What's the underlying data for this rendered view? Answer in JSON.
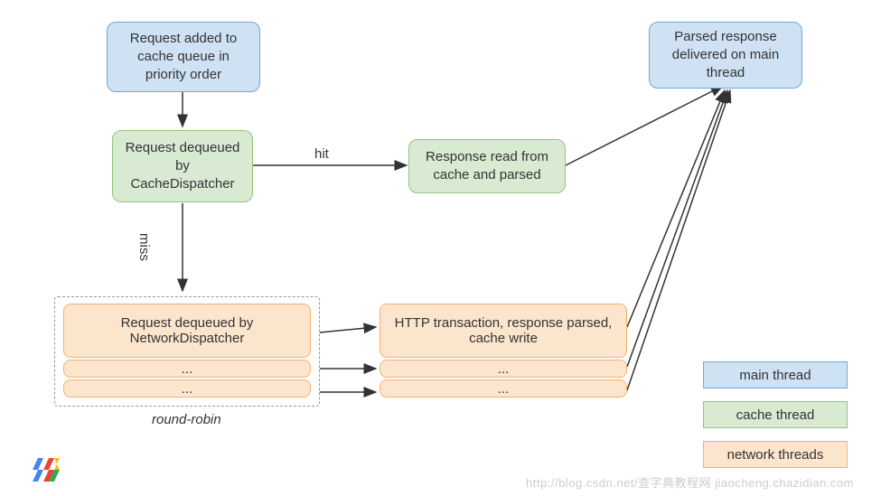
{
  "chart_data": {
    "type": "diagram",
    "title": "",
    "nodes": [
      {
        "id": "req_added",
        "label": "Request added to cache queue in priority order",
        "thread": "main"
      },
      {
        "id": "cache_dispatch",
        "label": "Request dequeued by CacheDispatcher",
        "thread": "cache"
      },
      {
        "id": "cache_read",
        "label": "Response read from cache and parsed",
        "thread": "cache"
      },
      {
        "id": "parsed_delivered",
        "label": "Parsed response delivered on main thread",
        "thread": "main"
      },
      {
        "id": "net_dispatch",
        "label": "Request dequeued by NetworkDispatcher",
        "thread": "network",
        "stacked": 3
      },
      {
        "id": "http_txn",
        "label": "HTTP transaction, response parsed, cache write",
        "thread": "network",
        "stacked": 3
      }
    ],
    "edges": [
      {
        "from": "req_added",
        "to": "cache_dispatch"
      },
      {
        "from": "cache_dispatch",
        "to": "cache_read",
        "label": "hit"
      },
      {
        "from": "cache_read",
        "to": "parsed_delivered"
      },
      {
        "from": "cache_dispatch",
        "to": "net_dispatch",
        "label": "miss"
      },
      {
        "from": "net_dispatch",
        "to": "http_txn",
        "fanout": 3
      },
      {
        "from": "http_txn",
        "to": "parsed_delivered",
        "fanin": 3
      }
    ],
    "annotations": [
      {
        "text": "round-robin",
        "near": "net_dispatch",
        "style": "italic"
      }
    ],
    "legend": [
      {
        "label": "main thread",
        "thread": "main"
      },
      {
        "label": "cache thread",
        "thread": "cache"
      },
      {
        "label": "network threads",
        "thread": "network"
      }
    ]
  },
  "nodes": {
    "req_added": "Request added to cache queue in priority order",
    "cache_dispatch": "Request dequeued by CacheDispatcher",
    "cache_read": "Response read from cache and parsed",
    "parsed_delivered": "Parsed response delivered on main thread",
    "net_dispatch": "Request dequeued by NetworkDispatcher",
    "http_txn": "HTTP transaction, response parsed, cache write",
    "ellipsis": "..."
  },
  "edge_labels": {
    "hit": "hit",
    "miss": "miss"
  },
  "annotations": {
    "round_robin": "round-robin"
  },
  "legend": {
    "main": "main thread",
    "cache": "cache thread",
    "network": "network threads"
  },
  "watermark": "http://blog.csdn.net/查字典教程网 jiaocheng.chazidian.com"
}
